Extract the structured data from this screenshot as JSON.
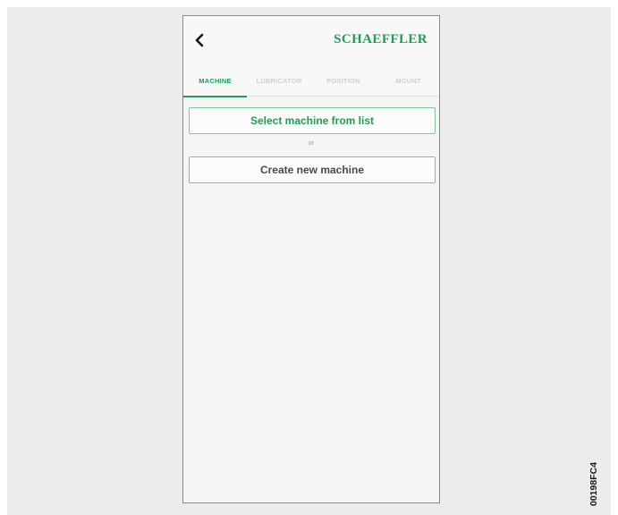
{
  "header": {
    "back_icon": "chevron-left-icon",
    "brand": "SCHAEFFLER"
  },
  "tabs": [
    {
      "label": "MACHINE",
      "active": true
    },
    {
      "label": "LUBRICATOR",
      "active": false
    },
    {
      "label": "POSITION",
      "active": false
    },
    {
      "label": "MOUNT",
      "active": false
    }
  ],
  "main": {
    "select_button": "Select machine from list",
    "or_text": "or",
    "create_button": "Create new machine"
  },
  "figure_code": "00198FC4",
  "colors": {
    "accent": "#1f9d55",
    "inactive_tab": "#cfcfcf"
  }
}
